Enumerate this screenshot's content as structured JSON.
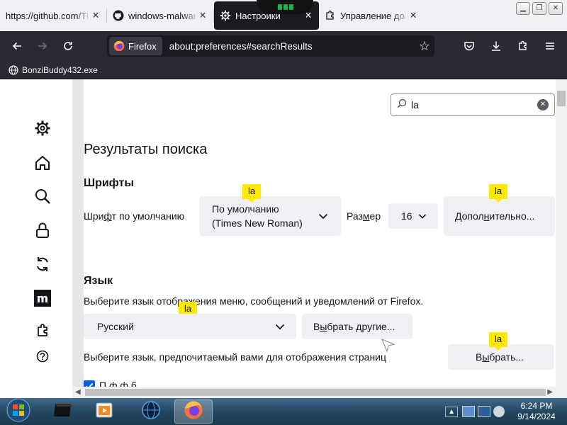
{
  "tabs": [
    {
      "label": "https://github.com/TI",
      "favicon": "none"
    },
    {
      "label": "windows-malware",
      "favicon": "github-icon"
    },
    {
      "label": "Настройки",
      "favicon": "gear-icon",
      "active": true
    },
    {
      "label": "Управление допол",
      "favicon": "extension-icon"
    }
  ],
  "tab_close_glyph": "✕",
  "navbar": {
    "identity_label": "Firefox",
    "url": "about:preferences#searchResults"
  },
  "bookmarks": [
    {
      "label": "BonziBuddy432.exe"
    }
  ],
  "search": {
    "value": "la"
  },
  "page": {
    "results_heading": "Результаты поиска",
    "fonts": {
      "heading": "Шрифты",
      "default_font_label_pre": "Шри",
      "default_font_label_u": "ф",
      "default_font_label_post": "т по умолчанию",
      "font_value_line1": "По умолчанию",
      "font_value_line2": "(Times New Roman)",
      "size_label_pre": "Раз",
      "size_label_u": "м",
      "size_label_post": "ер",
      "size_value": "16",
      "advanced_pre": "Допол",
      "advanced_u": "н",
      "advanced_post": "ительно..."
    },
    "language": {
      "heading": "Язык",
      "desc": "Выберите язык отображения меню, сообщений и уведомлений от Firefox.",
      "current": "Русский",
      "choose_others_pre": "В",
      "choose_others_u": "ы",
      "choose_others_post": "брать другие...",
      "page_lang_desc": "Выберите язык, предпочитаемый вами для отображения страниц",
      "choose_pre": "В",
      "choose_u": "ы",
      "choose_post": "брать...",
      "cut_text": "П                  ф                  ф              б"
    },
    "highlight": "la"
  },
  "taskbar": {
    "time": "6:24 PM",
    "date": "9/14/2024"
  },
  "colors": {
    "accent": "#0061e0",
    "highlight": "#ffe900",
    "toolbar": "#2b2a33"
  }
}
